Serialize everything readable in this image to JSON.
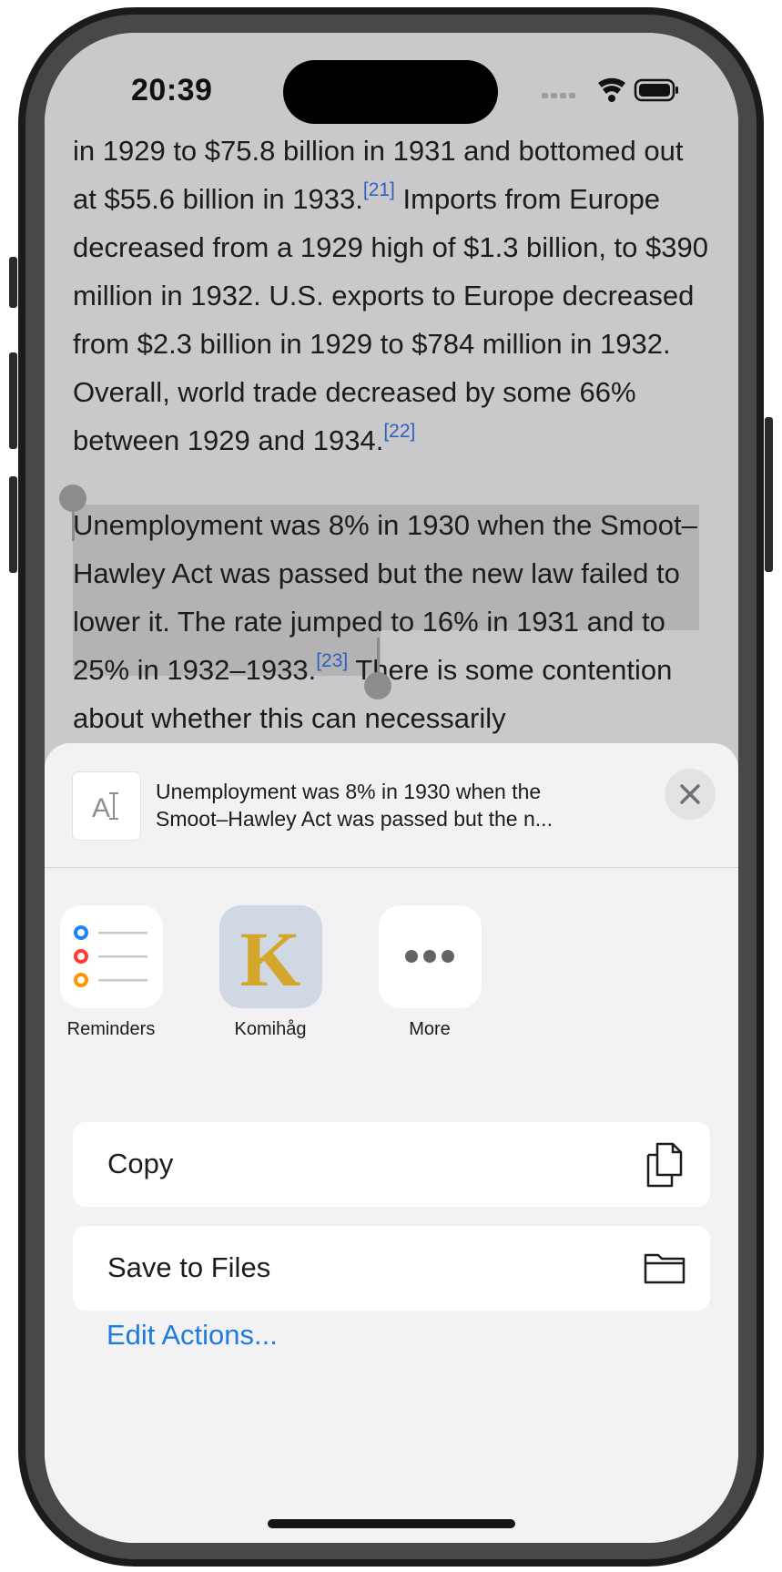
{
  "status_bar": {
    "time": "20:39"
  },
  "article": {
    "para1": {
      "text_a": "in 1929 to $75.8 billion in 1931 and bottomed out at $55.6 billion in 1933.",
      "ref_a": "[21]",
      "text_b": " Imports from Europe decreased from a 1929 high of $1.3 billion, to $390 million in 1932. U.S. exports to Europe decreased from $2.3 billion in 1929 to $784 million in 1932. Overall, world trade decreased by some 66% between 1929 and 1934.",
      "ref_b": "[22]"
    },
    "para2": {
      "text_a": "Unemployment was 8% in 1930 when the Smoot–Hawley Act was passed but the new law failed to lower it. The rate jumped to 16% in 1931 and to 25% in 1932–1933.",
      "ref_a": "[23]",
      "text_b": " There is some contention about whether this can necessarily"
    }
  },
  "share_sheet": {
    "preview_line1": "Unemployment was 8% in 1930 when the",
    "preview_line2": "Smoot–Hawley Act was passed but the n...",
    "apps": [
      {
        "label": "Reminders",
        "icon": "reminders-icon"
      },
      {
        "label": "Komihåg",
        "icon": "komihag-icon",
        "glyph": "K"
      },
      {
        "label": "More",
        "icon": "more-icon"
      }
    ],
    "actions": [
      {
        "label": "Copy",
        "icon": "copy-icon"
      },
      {
        "label": "Save to Files",
        "icon": "folder-icon"
      }
    ],
    "edit_actions": "Edit Actions..."
  },
  "colors": {
    "accent": "#1f7ae0",
    "reference_link": "#2f5fbf",
    "komihag_gold": "#d4a72c",
    "reminder_blue": "#1a84ff",
    "reminder_red": "#ff3b30",
    "reminder_orange": "#ff9500"
  }
}
